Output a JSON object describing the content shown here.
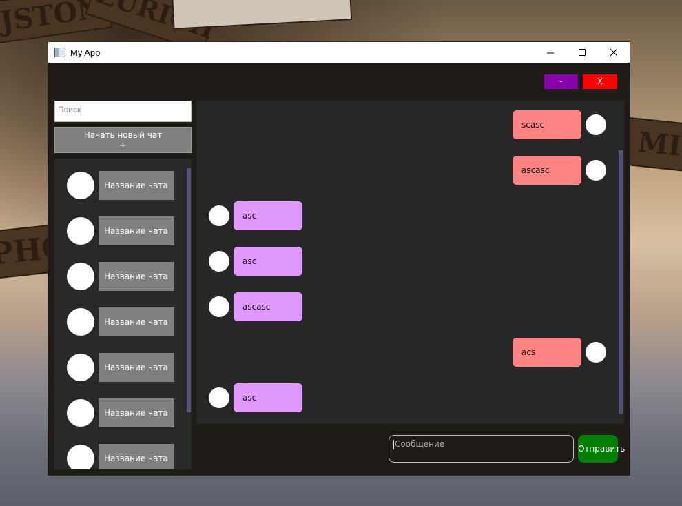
{
  "background_signs": [
    "JSTON",
    "ZURICH",
    "PHO",
    "MI"
  ],
  "window": {
    "title": "My App"
  },
  "header": {
    "minimize_label": "-",
    "close_label": "X"
  },
  "search": {
    "placeholder": "Поиск"
  },
  "new_chat": {
    "label": "Начать новый чат",
    "plus": "+"
  },
  "chats": [
    {
      "name": "Название чата"
    },
    {
      "name": "Название чата"
    },
    {
      "name": "Название чата"
    },
    {
      "name": "Название чата"
    },
    {
      "name": "Название чата"
    },
    {
      "name": "Название чата"
    },
    {
      "name": "Название чата"
    }
  ],
  "messages": [
    {
      "text": "scasc",
      "direction": "out"
    },
    {
      "text": "ascasc",
      "direction": "out"
    },
    {
      "text": "asc",
      "direction": "in"
    },
    {
      "text": "asc",
      "direction": "in"
    },
    {
      "text": "ascasc",
      "direction": "in"
    },
    {
      "text": "acs",
      "direction": "out"
    },
    {
      "text": "asc",
      "direction": "in"
    }
  ],
  "compose": {
    "placeholder": "Сообщение",
    "send_label": "Отправить"
  },
  "colors": {
    "outgoing": "#ff8585",
    "incoming": "#e199ff",
    "send": "#008000",
    "minimize": "#8b00ad",
    "close": "#ff0000"
  }
}
